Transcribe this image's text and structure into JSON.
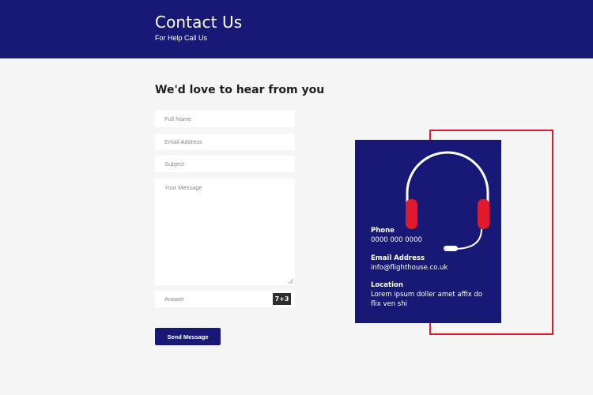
{
  "header": {
    "title": "Contact Us",
    "subtitle": "For Help Call Us"
  },
  "form": {
    "heading": "We'd love to hear from you",
    "full_name_placeholder": "Full Name",
    "email_placeholder": "Email Address",
    "subject_placeholder": "Subject",
    "message_placeholder": "Your Message",
    "answer_placeholder": "Answer",
    "captcha": "7+3",
    "send_label": "Send Message"
  },
  "contact_card": {
    "icon": "headset-icon",
    "phone_label": "Phone",
    "phone_value": "0000 000 0000",
    "email_label": "Email Address",
    "email_value": "info@flighthouse.co.uk",
    "location_label": "Location",
    "location_value": "Lorem ipsum doller amet affix do flix ven shi"
  },
  "colors": {
    "navy": "#181877",
    "red": "#e0192d",
    "background": "#f5f5f6"
  }
}
